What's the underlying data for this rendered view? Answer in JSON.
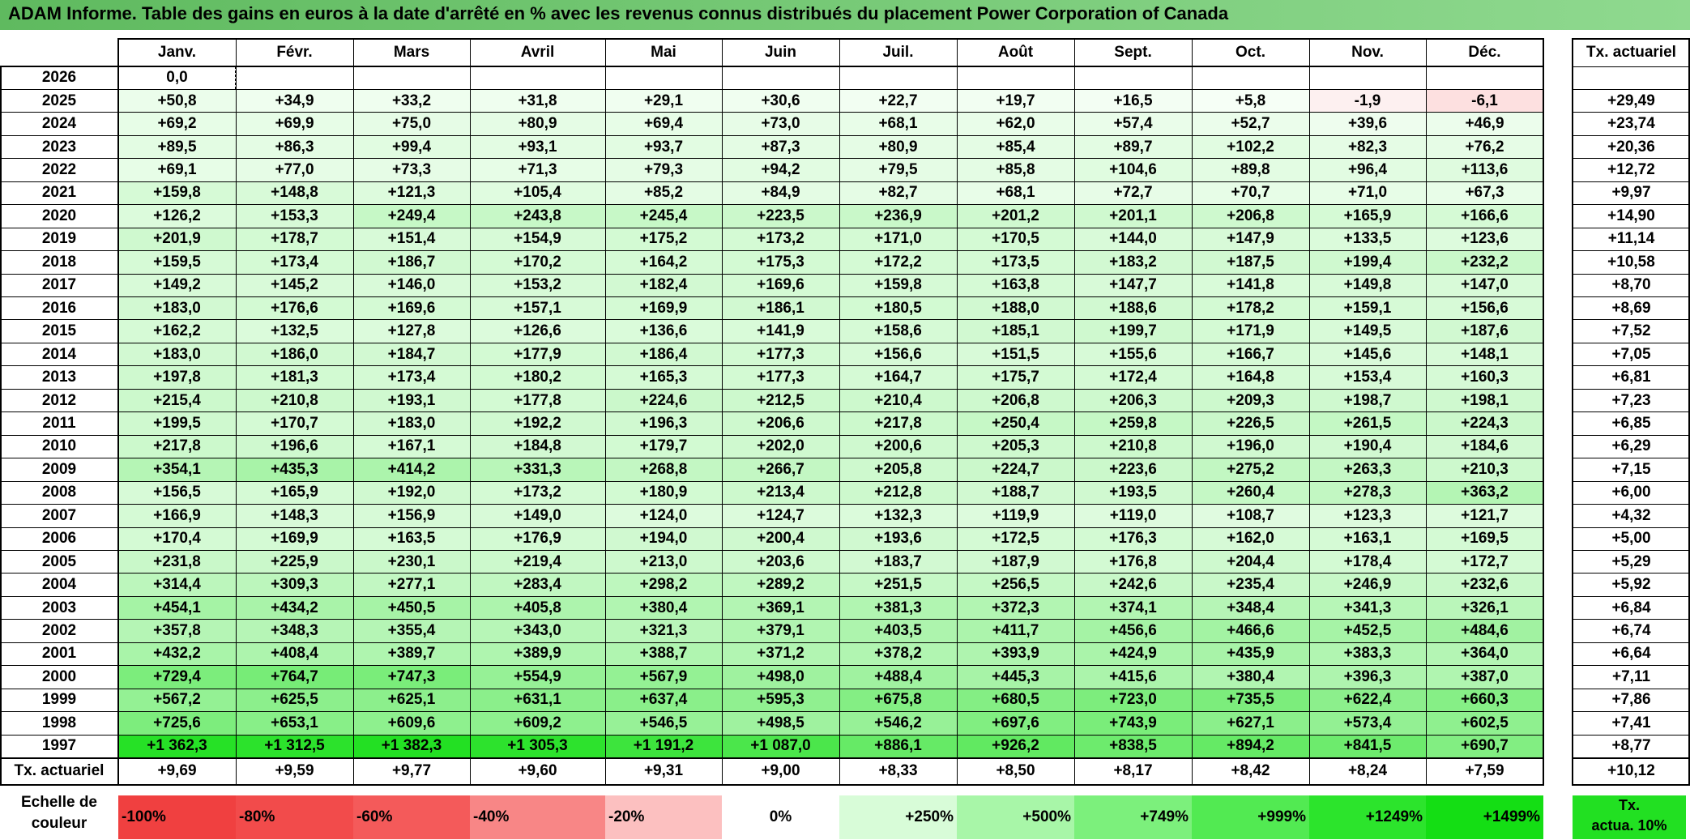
{
  "title": "ADAM Informe. Table des gains en euros à la date d'arrêté en % avec les revenus connus distribués du placement Power Corporation of Canada",
  "months": [
    "Janv.",
    "Févr.",
    "Mars",
    "Avril",
    "Mai",
    "Juin",
    "Juil.",
    "Août",
    "Sept.",
    "Oct.",
    "Nov.",
    "Déc."
  ],
  "actuarial_header": "Tx. actuariel",
  "rows": [
    {
      "year": "2026",
      "values": [
        "0,0",
        "",
        "",
        "",
        "",
        "",
        "",
        "",
        "",
        "",
        "",
        ""
      ],
      "act": ""
    },
    {
      "year": "2025",
      "values": [
        "+50,8",
        "+34,9",
        "+33,2",
        "+31,8",
        "+29,1",
        "+30,6",
        "+22,7",
        "+19,7",
        "+16,5",
        "+5,8",
        "-1,9",
        "-6,1"
      ],
      "act": "+29,49"
    },
    {
      "year": "2024",
      "values": [
        "+69,2",
        "+69,9",
        "+75,0",
        "+80,9",
        "+69,4",
        "+73,0",
        "+68,1",
        "+62,0",
        "+57,4",
        "+52,7",
        "+39,6",
        "+46,9"
      ],
      "act": "+23,74"
    },
    {
      "year": "2023",
      "values": [
        "+89,5",
        "+86,3",
        "+99,4",
        "+93,1",
        "+93,7",
        "+87,3",
        "+80,9",
        "+85,4",
        "+89,7",
        "+102,2",
        "+82,3",
        "+76,2"
      ],
      "act": "+20,36"
    },
    {
      "year": "2022",
      "values": [
        "+69,1",
        "+77,0",
        "+73,3",
        "+71,3",
        "+79,3",
        "+94,2",
        "+79,5",
        "+85,8",
        "+104,6",
        "+89,8",
        "+96,4",
        "+113,6"
      ],
      "act": "+12,72"
    },
    {
      "year": "2021",
      "values": [
        "+159,8",
        "+148,8",
        "+121,3",
        "+105,4",
        "+85,2",
        "+84,9",
        "+82,7",
        "+68,1",
        "+72,7",
        "+70,7",
        "+71,0",
        "+67,3"
      ],
      "act": "+9,97"
    },
    {
      "year": "2020",
      "values": [
        "+126,2",
        "+153,3",
        "+249,4",
        "+243,8",
        "+245,4",
        "+223,5",
        "+236,9",
        "+201,2",
        "+201,1",
        "+206,8",
        "+165,9",
        "+166,6"
      ],
      "act": "+14,90"
    },
    {
      "year": "2019",
      "values": [
        "+201,9",
        "+178,7",
        "+151,4",
        "+154,9",
        "+175,2",
        "+173,2",
        "+171,0",
        "+170,5",
        "+144,0",
        "+147,9",
        "+133,5",
        "+123,6"
      ],
      "act": "+11,14"
    },
    {
      "year": "2018",
      "values": [
        "+159,5",
        "+173,4",
        "+186,7",
        "+170,2",
        "+164,2",
        "+175,3",
        "+172,2",
        "+173,5",
        "+183,2",
        "+187,5",
        "+199,4",
        "+232,2"
      ],
      "act": "+10,58"
    },
    {
      "year": "2017",
      "values": [
        "+149,2",
        "+145,2",
        "+146,0",
        "+153,2",
        "+182,4",
        "+169,6",
        "+159,8",
        "+163,8",
        "+147,7",
        "+141,8",
        "+149,8",
        "+147,0"
      ],
      "act": "+8,70"
    },
    {
      "year": "2016",
      "values": [
        "+183,0",
        "+176,6",
        "+169,6",
        "+157,1",
        "+169,9",
        "+186,1",
        "+180,5",
        "+188,0",
        "+188,6",
        "+178,2",
        "+159,1",
        "+156,6"
      ],
      "act": "+8,69"
    },
    {
      "year": "2015",
      "values": [
        "+162,2",
        "+132,5",
        "+127,8",
        "+126,6",
        "+136,6",
        "+141,9",
        "+158,6",
        "+185,1",
        "+199,7",
        "+171,9",
        "+149,5",
        "+187,6"
      ],
      "act": "+7,52"
    },
    {
      "year": "2014",
      "values": [
        "+183,0",
        "+186,0",
        "+184,7",
        "+177,9",
        "+186,4",
        "+177,3",
        "+156,6",
        "+151,5",
        "+155,6",
        "+166,7",
        "+145,6",
        "+148,1"
      ],
      "act": "+7,05"
    },
    {
      "year": "2013",
      "values": [
        "+197,8",
        "+181,3",
        "+173,4",
        "+180,2",
        "+165,3",
        "+177,3",
        "+164,7",
        "+175,7",
        "+172,4",
        "+164,8",
        "+153,4",
        "+160,3"
      ],
      "act": "+6,81"
    },
    {
      "year": "2012",
      "values": [
        "+215,4",
        "+210,8",
        "+193,1",
        "+177,8",
        "+224,6",
        "+212,5",
        "+210,4",
        "+206,8",
        "+206,3",
        "+209,3",
        "+198,7",
        "+198,1"
      ],
      "act": "+7,23"
    },
    {
      "year": "2011",
      "values": [
        "+199,5",
        "+170,7",
        "+183,0",
        "+192,2",
        "+196,3",
        "+206,6",
        "+217,8",
        "+250,4",
        "+259,8",
        "+226,5",
        "+261,5",
        "+224,3"
      ],
      "act": "+6,85"
    },
    {
      "year": "2010",
      "values": [
        "+217,8",
        "+196,6",
        "+167,1",
        "+184,8",
        "+179,7",
        "+202,0",
        "+200,6",
        "+205,3",
        "+210,8",
        "+196,0",
        "+190,4",
        "+184,6"
      ],
      "act": "+6,29"
    },
    {
      "year": "2009",
      "values": [
        "+354,1",
        "+435,3",
        "+414,2",
        "+331,3",
        "+268,8",
        "+266,7",
        "+205,8",
        "+224,7",
        "+223,6",
        "+275,2",
        "+263,3",
        "+210,3"
      ],
      "act": "+7,15"
    },
    {
      "year": "2008",
      "values": [
        "+156,5",
        "+165,9",
        "+192,0",
        "+173,2",
        "+180,9",
        "+213,4",
        "+212,8",
        "+188,7",
        "+193,5",
        "+260,4",
        "+278,3",
        "+363,2"
      ],
      "act": "+6,00"
    },
    {
      "year": "2007",
      "values": [
        "+166,9",
        "+148,3",
        "+156,9",
        "+149,0",
        "+124,0",
        "+124,7",
        "+132,3",
        "+119,9",
        "+119,0",
        "+108,7",
        "+123,3",
        "+121,7"
      ],
      "act": "+4,32"
    },
    {
      "year": "2006",
      "values": [
        "+170,4",
        "+169,9",
        "+163,5",
        "+176,9",
        "+194,0",
        "+200,4",
        "+193,6",
        "+172,5",
        "+176,3",
        "+162,0",
        "+163,1",
        "+169,5"
      ],
      "act": "+5,00"
    },
    {
      "year": "2005",
      "values": [
        "+231,8",
        "+225,9",
        "+230,1",
        "+219,4",
        "+213,0",
        "+203,6",
        "+183,7",
        "+187,9",
        "+176,8",
        "+204,4",
        "+178,4",
        "+172,7"
      ],
      "act": "+5,29"
    },
    {
      "year": "2004",
      "values": [
        "+314,4",
        "+309,3",
        "+277,1",
        "+283,4",
        "+298,2",
        "+289,2",
        "+251,5",
        "+256,5",
        "+242,6",
        "+235,4",
        "+246,9",
        "+232,6"
      ],
      "act": "+5,92"
    },
    {
      "year": "2003",
      "values": [
        "+454,1",
        "+434,2",
        "+450,5",
        "+405,8",
        "+380,4",
        "+369,1",
        "+381,3",
        "+372,3",
        "+374,1",
        "+348,4",
        "+341,3",
        "+326,1"
      ],
      "act": "+6,84"
    },
    {
      "year": "2002",
      "values": [
        "+357,8",
        "+348,3",
        "+355,4",
        "+343,0",
        "+321,3",
        "+379,1",
        "+403,5",
        "+411,7",
        "+456,6",
        "+466,6",
        "+452,5",
        "+484,6"
      ],
      "act": "+6,74"
    },
    {
      "year": "2001",
      "values": [
        "+432,2",
        "+408,4",
        "+389,7",
        "+389,9",
        "+388,7",
        "+371,2",
        "+378,2",
        "+393,9",
        "+424,9",
        "+435,9",
        "+383,3",
        "+364,0"
      ],
      "act": "+6,64"
    },
    {
      "year": "2000",
      "values": [
        "+729,4",
        "+764,7",
        "+747,3",
        "+554,9",
        "+567,9",
        "+498,0",
        "+488,4",
        "+445,3",
        "+415,6",
        "+380,4",
        "+396,3",
        "+387,0"
      ],
      "act": "+7,11"
    },
    {
      "year": "1999",
      "values": [
        "+567,2",
        "+625,5",
        "+625,1",
        "+631,1",
        "+637,4",
        "+595,3",
        "+675,8",
        "+680,5",
        "+723,0",
        "+735,5",
        "+622,4",
        "+660,3"
      ],
      "act": "+7,86"
    },
    {
      "year": "1998",
      "values": [
        "+725,6",
        "+653,1",
        "+609,6",
        "+609,2",
        "+546,5",
        "+498,5",
        "+546,2",
        "+697,6",
        "+743,9",
        "+627,1",
        "+573,4",
        "+602,5"
      ],
      "act": "+7,41"
    },
    {
      "year": "1997",
      "values": [
        "+1 362,3",
        "+1 312,5",
        "+1 382,3",
        "+1 305,3",
        "+1 191,2",
        "+1 087,0",
        "+886,1",
        "+926,2",
        "+838,5",
        "+894,2",
        "+841,5",
        "+690,7"
      ],
      "act": "+8,77"
    }
  ],
  "footer": {
    "label": "Tx. actuariel",
    "values": [
      "+9,69",
      "+9,59",
      "+9,77",
      "+9,60",
      "+9,31",
      "+9,00",
      "+8,33",
      "+8,50",
      "+8,17",
      "+8,42",
      "+8,24",
      "+7,59"
    ],
    "act": "+10,12"
  },
  "legend": {
    "label_line1": "Echelle de",
    "label_line2": "couleur",
    "steps": [
      {
        "text": "-100%",
        "align": "left",
        "color": "#f04040"
      },
      {
        "text": "-80%",
        "align": "left",
        "color": "#f24b4b"
      },
      {
        "text": "-60%",
        "align": "left",
        "color": "#f45a5a"
      },
      {
        "text": "-40%",
        "align": "left",
        "color": "#f88686"
      },
      {
        "text": "-20%",
        "align": "left",
        "color": "#fcc0c0"
      },
      {
        "text": "0%",
        "align": "center",
        "color": "#ffffff"
      },
      {
        "text": "+250%",
        "align": "right",
        "color": "#d8fcd8"
      },
      {
        "text": "+500%",
        "align": "right",
        "color": "#a8f6a8"
      },
      {
        "text": "+749%",
        "align": "right",
        "color": "#7cf07c"
      },
      {
        "text": "+999%",
        "align": "right",
        "color": "#52ea52"
      },
      {
        "text": "+1249%",
        "align": "right",
        "color": "#2ce42c"
      },
      {
        "text": "+1499%",
        "align": "right",
        "color": "#14de14"
      }
    ],
    "act_line1": "Tx.",
    "act_line2": "actua. 10%",
    "act_color": "#22e022"
  }
}
